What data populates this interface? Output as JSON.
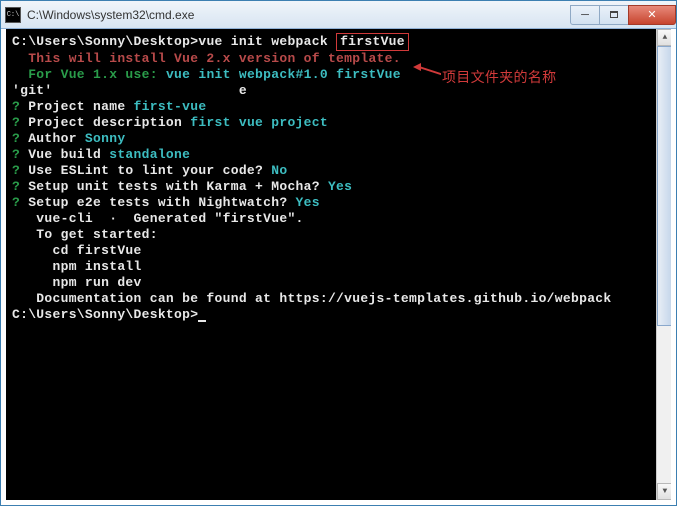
{
  "window": {
    "title": "C:\\Windows\\system32\\cmd.exe"
  },
  "annotation": {
    "label": "项目文件夹的名称"
  },
  "term": {
    "prompt1": "C:\\Users\\Sonny\\Desktop>",
    "cmd1a": "vue init webpack ",
    "cmd1b": "firstVue",
    "blank": "",
    "install_msg": "  This will install Vue 2.x version of template.",
    "vue1a": "  For Vue 1.x use: ",
    "vue1b": "vue init webpack#1.0 firstVue",
    "git_line": "'git'                       e",
    "q": "? ",
    "pn_label": "Project name ",
    "pn_val": "first-vue",
    "pd_label": "Project description ",
    "pd_val": "first vue project",
    "au_label": "Author ",
    "au_val": "Sonny",
    "vb_label": "Vue build ",
    "vb_val": "standalone",
    "es_label": "Use ESLint to lint your code? ",
    "es_val": "No",
    "ut_label": "Setup unit tests with Karma + Mocha? ",
    "ut_val": "Yes",
    "e2e_label": "Setup e2e tests with Nightwatch? ",
    "e2e_val": "Yes",
    "gen": "   vue-cli  ·  Generated \"firstVue\".",
    "start": "   To get started:",
    "cd": "     cd firstVue",
    "npm_i": "     npm install",
    "npm_r": "     npm run dev",
    "docs": "   Documentation can be found at https://vuejs-templates.github.io/webpack",
    "prompt2": "C:\\Users\\Sonny\\Desktop>"
  }
}
